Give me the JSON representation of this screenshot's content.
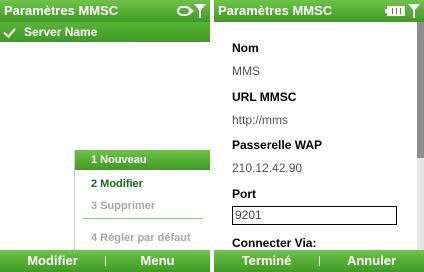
{
  "left": {
    "title": "Paramètres MMSC",
    "status_icons": [
      "sync-icon",
      "signal-icon"
    ],
    "list": [
      {
        "label": "Server Name",
        "checked": true
      }
    ],
    "menu": [
      {
        "label": "1 Nouveau",
        "selected": true,
        "enabled": true
      },
      {
        "label": "2 Modifier",
        "selected": false,
        "enabled": true
      },
      {
        "label": "3 Supprimer",
        "selected": false,
        "enabled": false
      },
      {
        "label": "4 Régler par défaut",
        "selected": false,
        "enabled": false
      }
    ],
    "softkeys": {
      "left": "Modifier",
      "right": "Menu"
    }
  },
  "right": {
    "title": "Paramètres MMSC",
    "status_icons": [
      "battery-icon",
      "signal-icon"
    ],
    "fields": {
      "nom": {
        "label": "Nom",
        "value": "MMS"
      },
      "url": {
        "label": "URL MMSC",
        "value": "http://mms"
      },
      "wap": {
        "label": "Passerelle WAP",
        "value": "210.12.42.90"
      },
      "port": {
        "label": "Port",
        "value": "9201"
      },
      "via": {
        "label": "Connecter Via:"
      }
    },
    "softkeys": {
      "left": "Terminé",
      "right": "Annuler"
    }
  },
  "colors": {
    "accent": "#3e9a25",
    "accent_light": "#6fc24a",
    "menu_text": "#1a6b1a",
    "disabled": "#a8a8a8"
  }
}
